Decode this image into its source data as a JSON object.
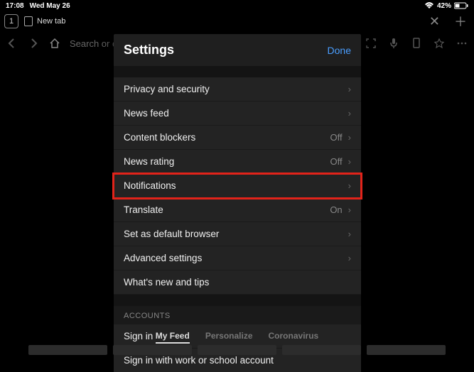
{
  "status": {
    "time": "17:08",
    "date": "Wed May 26",
    "battery": "42%"
  },
  "tabs": {
    "count": "1",
    "current_label": "New tab"
  },
  "toolbar": {
    "url_placeholder": "Search or ent"
  },
  "modal": {
    "title": "Settings",
    "done": "Done",
    "rows": [
      {
        "label": "Privacy and security",
        "value": ""
      },
      {
        "label": "News feed",
        "value": ""
      },
      {
        "label": "Content blockers",
        "value": "Off"
      },
      {
        "label": "News rating",
        "value": "Off"
      },
      {
        "label": "Notifications",
        "value": ""
      },
      {
        "label": "Translate",
        "value": "On"
      },
      {
        "label": "Set as default browser",
        "value": ""
      },
      {
        "label": "Advanced settings",
        "value": ""
      },
      {
        "label": "What's new and tips",
        "value": ""
      }
    ],
    "accounts_header": "ACCOUNTS",
    "account_rows": [
      {
        "label": "Sign in"
      },
      {
        "label": "Sign in with work or school account"
      }
    ]
  },
  "feed_tabs": {
    "my_feed": "My Feed",
    "personalize": "Personalize",
    "coronavirus": "Coronavirus"
  }
}
